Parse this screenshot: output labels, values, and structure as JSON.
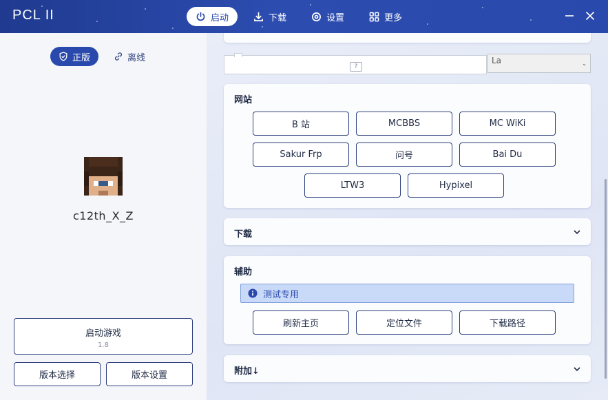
{
  "app": {
    "title": "PCL II"
  },
  "nav": {
    "launch": "启动",
    "download": "下载",
    "settings": "设置",
    "more": "更多"
  },
  "left": {
    "mode_official": "正版",
    "mode_offline": "离线",
    "username": "c12th_X_Z",
    "launch_label": "启动游戏",
    "launch_version": "1.8",
    "version_select": "版本选择",
    "version_settings": "版本设置"
  },
  "top_input": {
    "help": "?",
    "select_value": "La"
  },
  "websites": {
    "title": "网站",
    "buttons": [
      "B 站",
      "MCBBS",
      "MC WiKi",
      "Sakur Frp",
      "问号",
      "Bai Du",
      "LTW3",
      "Hypixel"
    ]
  },
  "download_section": {
    "title": "下载"
  },
  "helper": {
    "title": "辅助",
    "info": "测试专用",
    "buttons": [
      "刷新主页",
      "定位文件",
      "下载路径"
    ]
  },
  "extra": {
    "title": "附加↓"
  },
  "colors": {
    "accent": "#2a49ad",
    "titlebar": "#1f3a8f",
    "info_bg": "#c9daf9"
  }
}
